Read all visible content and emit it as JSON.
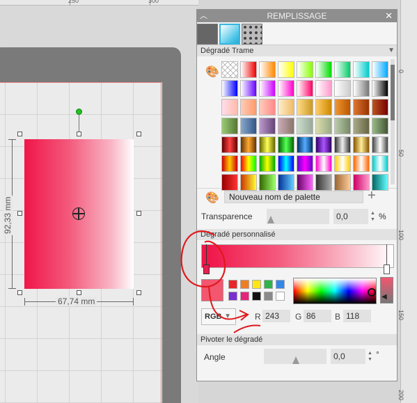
{
  "ruler_top": {
    "labels": [
      "250",
      "300"
    ]
  },
  "ruler_right": {
    "labels": [
      "0",
      "50",
      "100",
      "150",
      "200"
    ]
  },
  "canvas": {
    "dimension_height": "92,33 mm",
    "dimension_width": "67,74 mm"
  },
  "panel": {
    "title": "REMPLISSAGE",
    "tabs": [
      "solid-fill",
      "gradient-fill",
      "pattern-fill"
    ],
    "section_gradient_pattern": "Dégradé Trame",
    "swatches": [
      "linear-gradient(90deg,#fff,#e00)",
      "linear-gradient(90deg,#fff,#f80)",
      "linear-gradient(90deg,#fff,#ff0)",
      "linear-gradient(90deg,#fff,#8f0)",
      "linear-gradient(90deg,#fff,#0d0)",
      "linear-gradient(90deg,#fff,#0c6)",
      "linear-gradient(90deg,#fff,#0cc)",
      "linear-gradient(90deg,#fff,#0af)",
      "linear-gradient(90deg,#fff,#00f)",
      "linear-gradient(90deg,#fff,#60f)",
      "linear-gradient(90deg,#fff,#c0f)",
      "linear-gradient(90deg,#fff,#f0c)",
      "linear-gradient(90deg,#fff,#f06)",
      "linear-gradient(90deg,#fff,#f9c)",
      "linear-gradient(90deg,#fff,#ccc)",
      "linear-gradient(90deg,#fff,#777)",
      "linear-gradient(90deg,#fff,#000)",
      "linear-gradient(90deg,#fde,#fba)",
      "linear-gradient(90deg,#fcb,#f96)",
      "linear-gradient(90deg,#fcb,#f88)",
      "linear-gradient(90deg,#fec,#eb6)",
      "linear-gradient(90deg,#fd8,#c92)",
      "linear-gradient(90deg,#fc6,#c80)",
      "linear-gradient(90deg,#e93,#b50)",
      "linear-gradient(90deg,#d73,#930)",
      "linear-gradient(90deg,#b52,#700)",
      "linear-gradient(90deg,#9c7,#573)",
      "linear-gradient(90deg,#8ac,#358)",
      "linear-gradient(90deg,#b9c,#647)",
      "linear-gradient(90deg,#cab,#876)",
      "linear-gradient(90deg,#cdc,#9a9)",
      "linear-gradient(90deg,#dda,#9a8)",
      "linear-gradient(90deg,#bca,#786)",
      "linear-gradient(90deg,#aa8,#664)",
      "linear-gradient(90deg,#9b8,#453)",
      "linear-gradient(90deg,#600,#f44,#600)",
      "linear-gradient(90deg,#630,#fa3,#630)",
      "linear-gradient(90deg,#660,#ff5,#660)",
      "linear-gradient(90deg,#060,#5f5,#060)",
      "linear-gradient(90deg,#036,#5af,#036)",
      "linear-gradient(90deg,#306,#a5f,#306)",
      "linear-gradient(90deg,#333,#eee,#333)",
      "linear-gradient(90deg,#850,#fe9,#850)",
      "linear-gradient(90deg,#444,#fff,#444)",
      "linear-gradient(90deg,#c00,#fc0,#c00)",
      "linear-gradient(90deg,#f00,#ff0,#0f0)",
      "linear-gradient(90deg,#0a0,#ff0,#0a0)",
      "linear-gradient(90deg,#00f,#0ff,#00f)",
      "linear-gradient(90deg,#60c,#f0f,#60c)",
      "linear-gradient(90deg,#f0c,#fff,#f0c)",
      "linear-gradient(90deg,#fc0,#fff,#fc0)",
      "linear-gradient(90deg,#f60,#fff,#f60)",
      "linear-gradient(90deg,#0cc,#fff,#0cc)",
      "linear-gradient(90deg,#900,#f33)",
      "linear-gradient(90deg,#c30,#ff3)",
      "linear-gradient(90deg,#360,#9f6)",
      "linear-gradient(90deg,#039,#6cf)",
      "linear-gradient(90deg,#606,#f6f)",
      "linear-gradient(90deg,#333,#aaa)",
      "linear-gradient(90deg,#963,#fc9)",
      "linear-gradient(90deg,#c06,#f9c)",
      "linear-gradient(90deg,#066,#6ff)"
    ],
    "palette_name": "Nouveau nom de palette",
    "transparency_label": "Transparence",
    "transparency_value": "0,0",
    "transparency_unit": "%",
    "section_custom_gradient": "Dégradé personnalisé",
    "mini_swatches": [
      "#e9252a",
      "#f07d23",
      "#ffe614",
      "#2fb34a",
      "#3387e8",
      "#7a2ed1",
      "#e5247b",
      "#111111",
      "#8a8a8a",
      "#ffffff"
    ],
    "color_mode": "RGB",
    "r_label": "R",
    "r_value": "243",
    "g_label": "G",
    "g_value": "86",
    "b_label": "B",
    "b_value": "118",
    "section_rotate": "Pivoter le dégradé",
    "angle_label": "Angle",
    "angle_value": "0,0",
    "angle_unit": "°"
  },
  "colors": {
    "gradient_start": "#f0164a",
    "gradient_end": "#ffffff",
    "panel_title_bg": "#8e8e8e",
    "annotation_red": "#e0181c"
  }
}
